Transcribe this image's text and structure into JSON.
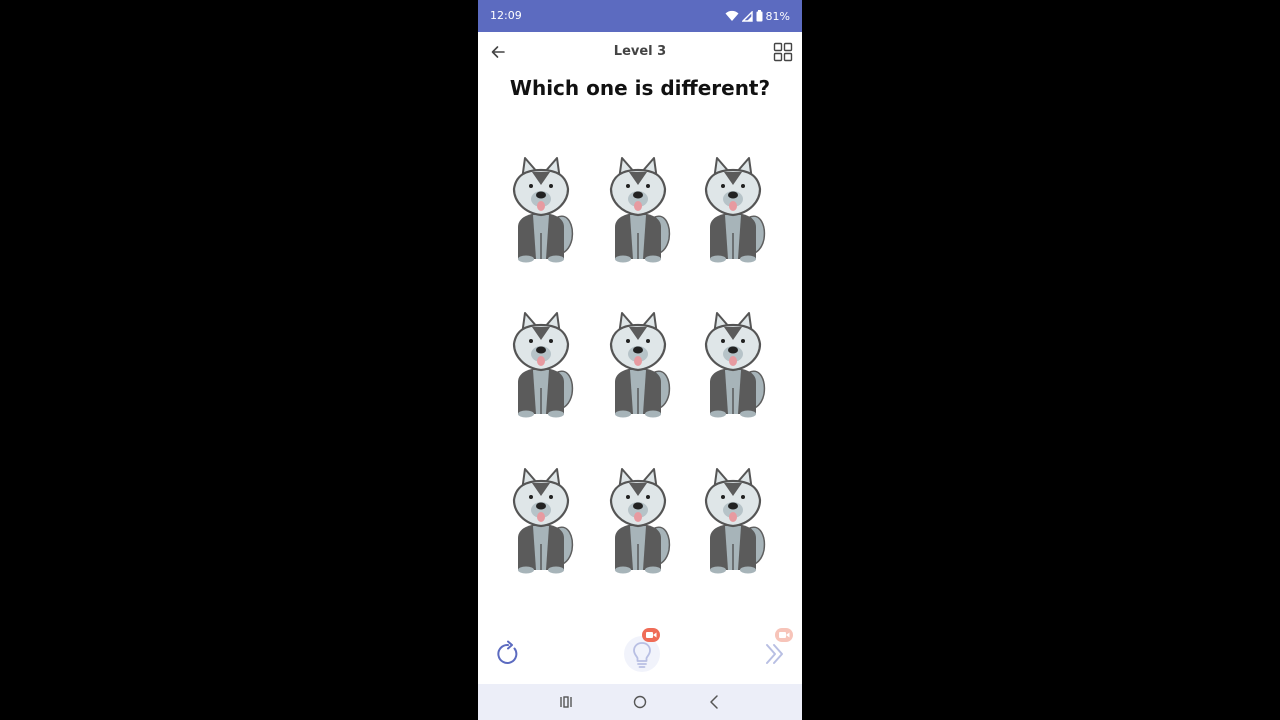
{
  "status_bar": {
    "time": "12:09",
    "battery": "81%"
  },
  "header": {
    "title": "Level 3"
  },
  "question": "Which one is different?",
  "grid": {
    "rows": 3,
    "columns": 3,
    "items": [
      "husky",
      "husky",
      "husky",
      "husky",
      "husky",
      "husky",
      "husky",
      "husky",
      "husky"
    ]
  },
  "controls": {
    "restart_icon": "restart-icon",
    "hint_icon": "lightbulb-icon",
    "skip_icon": "double-chevron-right-icon",
    "ad_badge_icon": "video-camera-icon"
  },
  "colors": {
    "status_bar": "#5c6bc0",
    "accent": "#5c6bc0",
    "badge": "#ef6c57",
    "badge_disabled": "#f7c4b9",
    "nav_bar": "#eceef8"
  }
}
